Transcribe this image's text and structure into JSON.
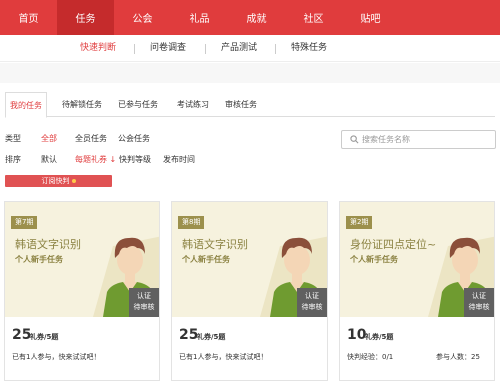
{
  "top_nav": {
    "items": [
      {
        "label": "首页"
      },
      {
        "label": "任务",
        "active": true
      },
      {
        "label": "公会"
      },
      {
        "label": "礼品"
      },
      {
        "label": "成就"
      },
      {
        "label": "社区"
      },
      {
        "label": "贴吧"
      }
    ]
  },
  "sub_nav": {
    "items": [
      {
        "label": "快速判断",
        "active": true
      },
      {
        "label": "问卷调查"
      },
      {
        "label": "产品测试"
      },
      {
        "label": "特殊任务"
      }
    ]
  },
  "tabs": {
    "items": [
      {
        "label": "我的任务",
        "active": true
      },
      {
        "label": "待解锁任务"
      },
      {
        "label": "已参与任务"
      },
      {
        "label": "考试练习"
      },
      {
        "label": "审核任务"
      }
    ]
  },
  "filters": {
    "type_label": "类型",
    "type_options": [
      "全部",
      "全员任务",
      "公会任务"
    ],
    "sort_label": "排序",
    "sort_options": [
      "默认",
      "每题礼券 ↓",
      "快判等级",
      "发布时间"
    ]
  },
  "search": {
    "placeholder": "搜索任务名称"
  },
  "subscribe": {
    "label": "订阅快判"
  },
  "cards": [
    {
      "period": "第7期",
      "title": "韩语文字识别",
      "subtitle": "个人新手任务",
      "badge_line1": "认证",
      "badge_line2": "待审核",
      "reward_value": "25",
      "reward_unit": "礼券/5题",
      "desc": "已有1人参与，快来试试吧！",
      "desc2": ""
    },
    {
      "period": "第8期",
      "title": "韩语文字识别",
      "subtitle": "个人新手任务",
      "badge_line1": "认证",
      "badge_line2": "待审核",
      "reward_value": "25",
      "reward_unit": "礼券/5题",
      "desc": "已有1人参与，快来试试吧！",
      "desc2": ""
    },
    {
      "period": "第2期",
      "title": "身份证四点定位~",
      "subtitle": "个人新手任务",
      "badge_line1": "认证",
      "badge_line2": "待审核",
      "reward_value": "10",
      "reward_unit": "礼券/5题",
      "desc": "快判经验：0/1",
      "desc2": "参与人数：25"
    }
  ],
  "colors": {
    "brand": "#e03c3d",
    "card_bg": "#f6f2de",
    "card_text": "#8b8242"
  }
}
